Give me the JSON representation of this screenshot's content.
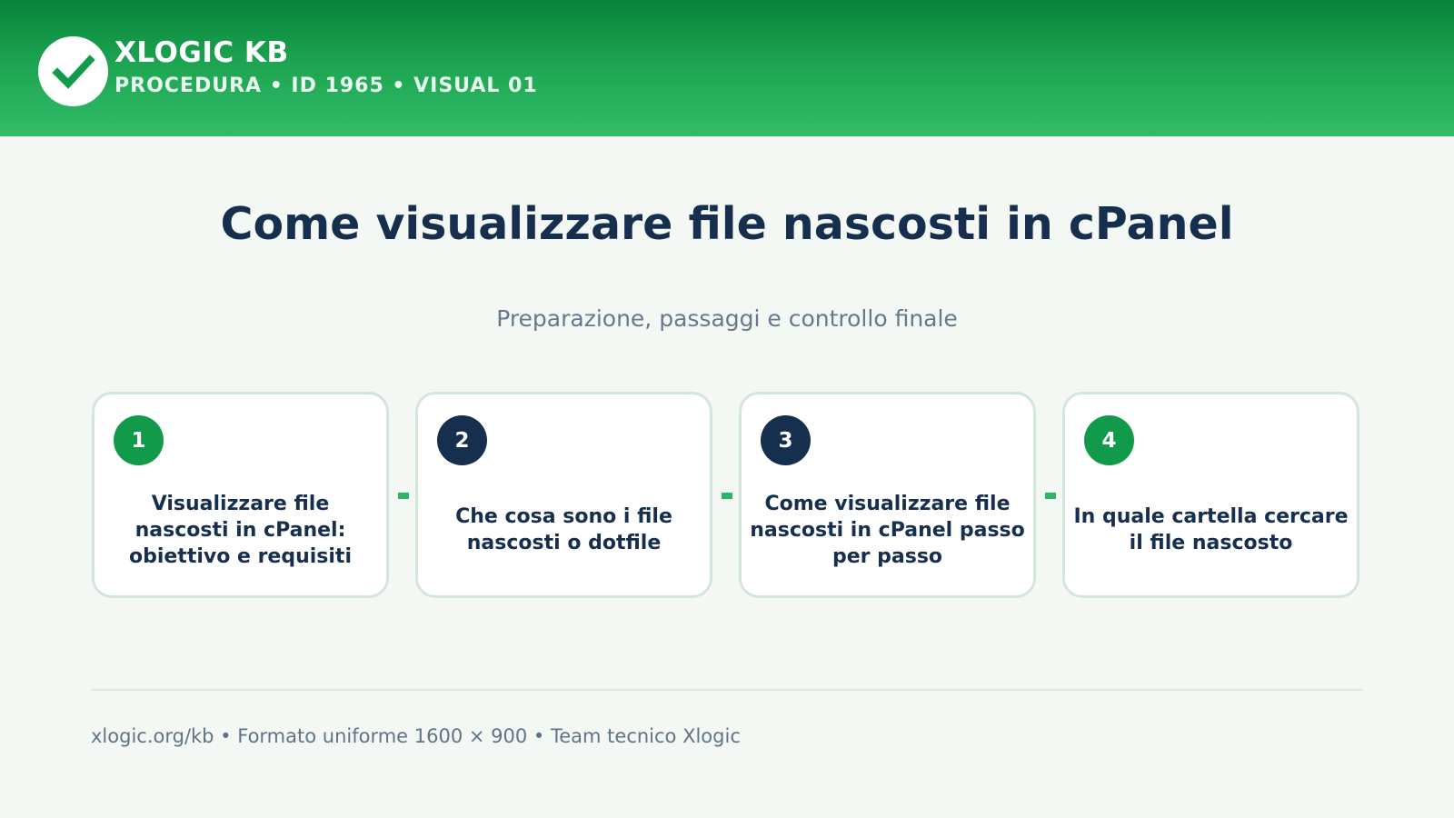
{
  "header": {
    "brand": "XLOGIC KB",
    "meta": "PROCEDURA • ID 1965 • VISUAL 01",
    "logo_icon": "checkmark-icon"
  },
  "main": {
    "title": "Come visualizzare file nascosti in cPanel",
    "subtitle": "Preparazione, passaggi e controllo finale"
  },
  "steps": [
    {
      "number": "1",
      "text": "Visualizzare file nascosti in cPanel: obiettivo e requisiti",
      "badge_color": "#129a4b"
    },
    {
      "number": "2",
      "text": "Che cosa sono i file nascosti o dotfile",
      "badge_color": "#172f4e"
    },
    {
      "number": "3",
      "text": "Come visualizzare file nascosti in cPanel passo per passo",
      "badge_color": "#172f4e"
    },
    {
      "number": "4",
      "text": "In quale cartella cercare il file nascosto",
      "badge_color": "#129a4b"
    }
  ],
  "footer": {
    "text": "xlogic.org/kb • Formato uniforme 1600 × 900 • Team tecnico Xlogic"
  },
  "colors": {
    "header_green": "#1fa653",
    "accent_green": "#129a4b",
    "navy": "#172f4e",
    "background": "#f4f8f5"
  }
}
